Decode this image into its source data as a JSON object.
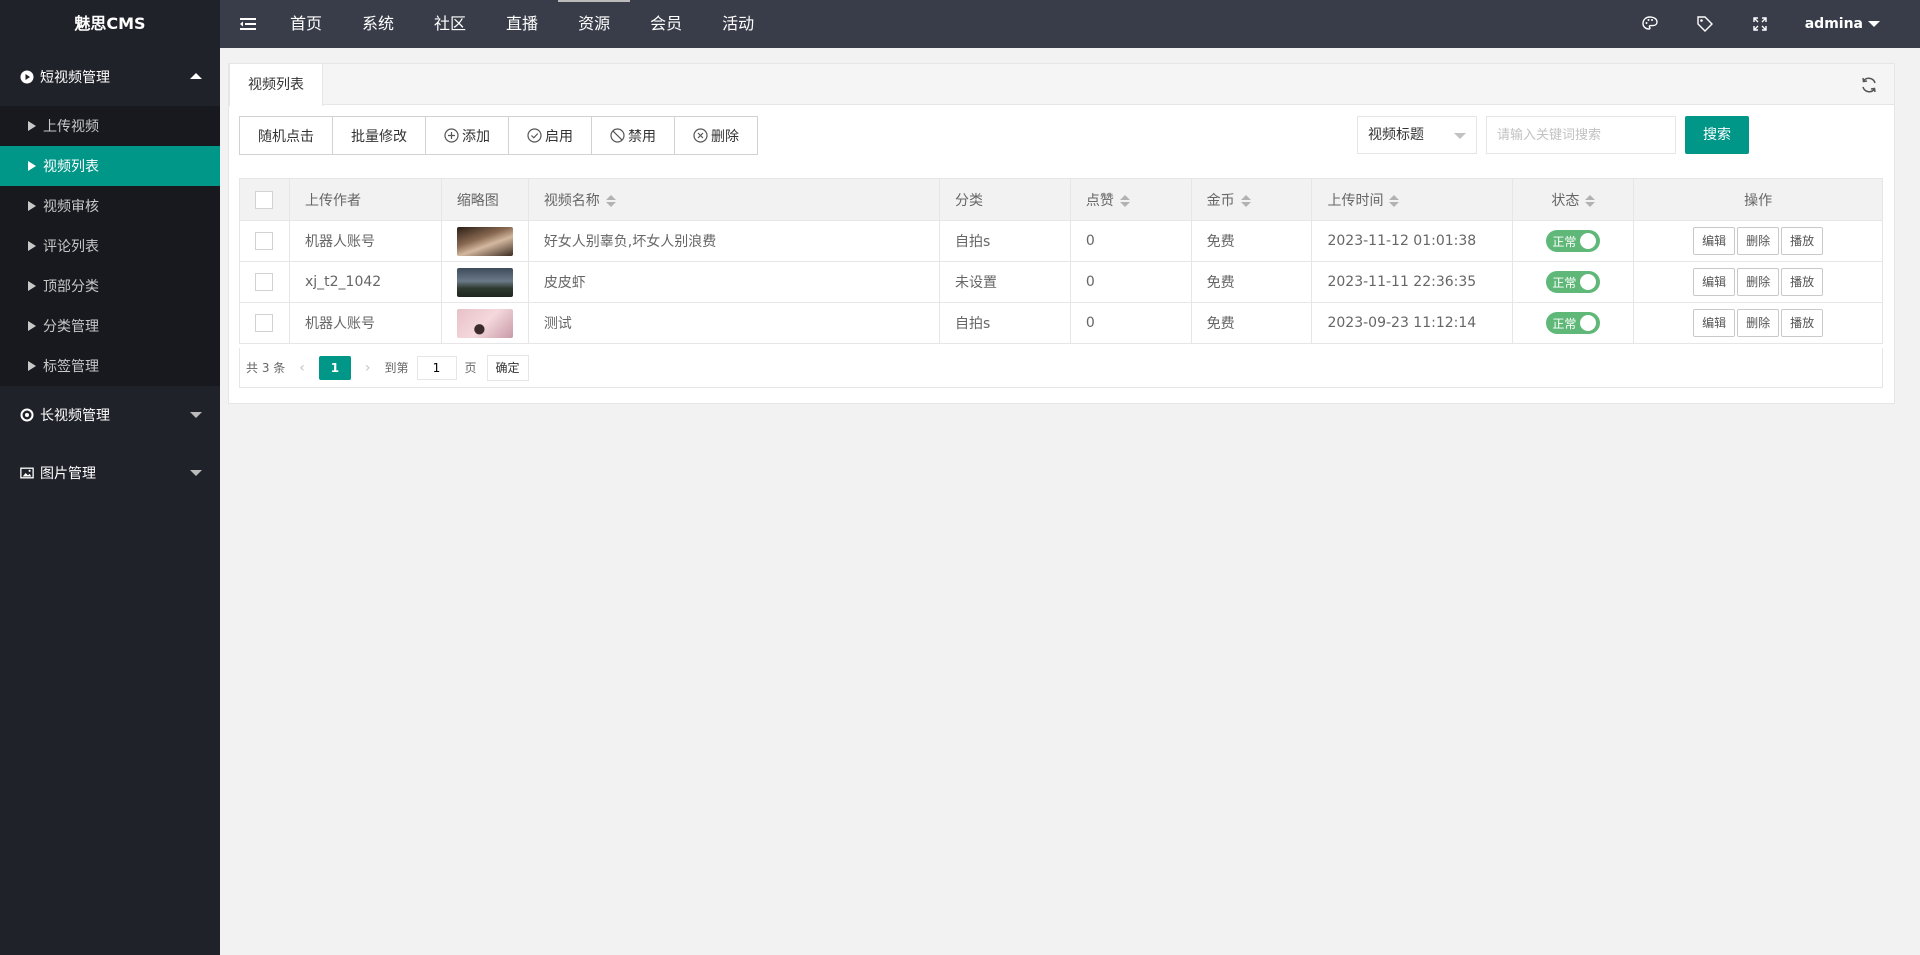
{
  "app": {
    "logo": "魅思CMS"
  },
  "header": {
    "nav": [
      "首页",
      "系统",
      "社区",
      "直播",
      "资源",
      "会员",
      "活动"
    ],
    "active_nav": 4,
    "user": "admina"
  },
  "sidebar": {
    "groups": [
      {
        "label": "短视频管理",
        "expanded": true,
        "items": [
          "上传视频",
          "视频列表",
          "视频审核",
          "评论列表",
          "顶部分类",
          "分类管理",
          "标签管理"
        ],
        "active_item": 1
      },
      {
        "label": "长视频管理",
        "expanded": false
      },
      {
        "label": "图片管理",
        "expanded": false
      }
    ]
  },
  "tab": {
    "label": "视频列表"
  },
  "toolbar": {
    "random": "随机点击",
    "batch": "批量修改",
    "add": "添加",
    "enable": "启用",
    "disable": "禁用",
    "delete": "删除"
  },
  "search": {
    "field": "视频标题",
    "placeholder": "请输入关键词搜索",
    "button": "搜索"
  },
  "table": {
    "headers": [
      "上传作者",
      "缩略图",
      "视频名称",
      "分类",
      "点赞",
      "金币",
      "上传时间",
      "状态",
      "操作"
    ],
    "rows": [
      {
        "author": "机器人账号",
        "title": "好女人别辜负,坏女人别浪费",
        "category": "自拍s",
        "likes": "0",
        "coins": "免费",
        "time": "2023-11-12 01:01:38",
        "status": "正常"
      },
      {
        "author": "xj_t2_1042",
        "title": "皮皮虾",
        "category": "未设置",
        "likes": "0",
        "coins": "免费",
        "time": "2023-11-11 22:36:35",
        "status": "正常"
      },
      {
        "author": "机器人账号",
        "title": "测试",
        "category": "自拍s",
        "likes": "0",
        "coins": "免费",
        "time": "2023-09-23 11:12:14",
        "status": "正常"
      }
    ],
    "actions": {
      "edit": "编辑",
      "delete": "删除",
      "play": "播放"
    }
  },
  "pagination": {
    "total": "共 3 条",
    "current": "1",
    "goto": "到第",
    "page_value": "1",
    "page_unit": "页",
    "confirm": "确定"
  },
  "colors": {
    "accent": "#009688",
    "switch_on": "#5fb878",
    "sidebar": "#20222a",
    "header": "#393d49"
  }
}
